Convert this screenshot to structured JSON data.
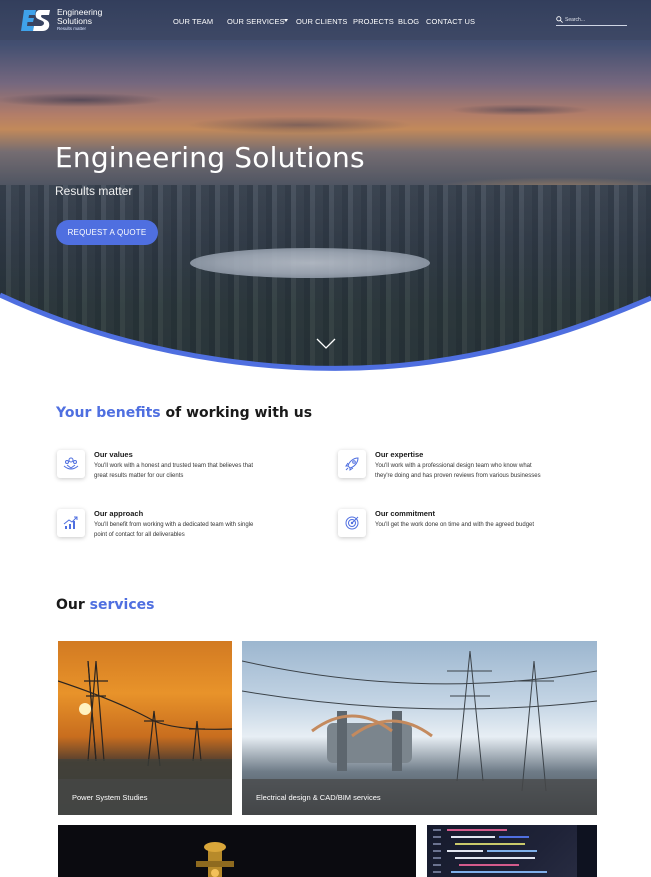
{
  "nav": {
    "logo": {
      "letters": "ES",
      "line1": "Engineering",
      "line2": "Solutions",
      "tagline": "Results matter"
    },
    "items": [
      {
        "label": "OUR TEAM",
        "has_dropdown": false
      },
      {
        "label": "OUR SERVICES",
        "has_dropdown": true
      },
      {
        "label": "OUR CLIENTS",
        "has_dropdown": false
      },
      {
        "label": "PROJECTS",
        "has_dropdown": false
      },
      {
        "label": "BLOG",
        "has_dropdown": false
      },
      {
        "label": "CONTACT US",
        "has_dropdown": false
      }
    ],
    "search": {
      "placeholder": "Search...",
      "value": ""
    }
  },
  "hero": {
    "title": "Engineering Solutions",
    "subtitle": "Results matter",
    "cta_label": "REQUEST A QUOTE"
  },
  "benefits": {
    "title_accent": "Your benefits",
    "title_rest": " of working with us",
    "items": [
      {
        "icon": "hands-team-icon",
        "title": "Our values",
        "text": "You'll work with a honest and trusted team that believes that great results matter for our clients"
      },
      {
        "icon": "rocket-icon",
        "title": "Our expertise",
        "text": "You'll work with a professional design team who know what they're doing and has proven reviews from various businesses"
      },
      {
        "icon": "growth-chart-icon",
        "title": "Our approach",
        "text": "You'll benefit from working with a dedicated team with single point of contact for all deliverables"
      },
      {
        "icon": "target-icon",
        "title": "Our commitment",
        "text": "You'll get the work done on time and with the agreed budget"
      }
    ]
  },
  "services": {
    "title_plain": "Our ",
    "title_accent": "services",
    "cards": [
      {
        "label": "Power System Studies"
      },
      {
        "label": "Electrical design & CAD/BIM services"
      },
      {
        "label": ""
      },
      {
        "label": ""
      }
    ]
  },
  "colors": {
    "accent": "#4f6fe0",
    "nav_bg": "#3c465f",
    "caption_bg": "#464646"
  }
}
